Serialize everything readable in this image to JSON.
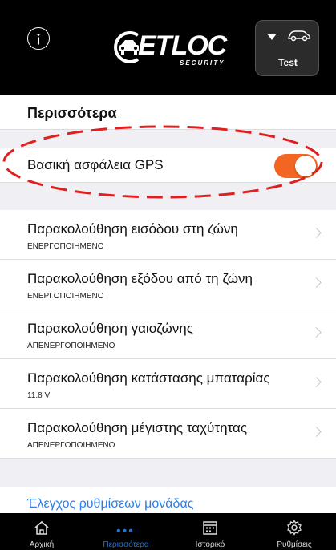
{
  "header": {
    "logo_text": "ETLOC",
    "logo_subtext": "SECURITY",
    "vehicle_name": "Test",
    "icons": {
      "info": "info-icon",
      "car": "car-icon",
      "caret": "caret-down-icon"
    }
  },
  "section": {
    "title": "Περισσότερα"
  },
  "gps": {
    "label": "Βασική ασφάλεια GPS",
    "enabled": true,
    "toggle_color": "#f26522"
  },
  "rows": [
    {
      "title": "Παρακολούθηση εισόδου στη ζώνη",
      "status": "ΕΝΕΡΓΟΠΟΙΗΜΕΝΟ"
    },
    {
      "title": "Παρακολούθηση εξόδου από τη ζώνη",
      "status": "ΕΝΕΡΓΟΠΟΙΗΜΕΝΟ"
    },
    {
      "title": "Παρακολούθηση γαιοζώνης",
      "status": "ΑΠΕΝΕΡΓΟΠΟΙΗΜΕΝΟ"
    },
    {
      "title": "Παρακολούθηση κατάστασης μπαταρίας",
      "status": "11.8 V"
    },
    {
      "title": "Παρακολούθηση μέγιστης ταχύτητας",
      "status": "ΑΠΕΝΕΡΓΟΠΟΙΗΜΕΝΟ"
    }
  ],
  "config_link": "Έλεγχος ρυθμίσεων μονάδας",
  "tabs": [
    {
      "label": "Αρχική",
      "icon": "home-icon",
      "active": false
    },
    {
      "label": "Περισσότερα",
      "icon": "more-dots-icon",
      "active": true
    },
    {
      "label": "Ιστορικό",
      "icon": "calendar-icon",
      "active": false
    },
    {
      "label": "Ρυθμίσεις",
      "icon": "gear-icon",
      "active": false
    }
  ],
  "colors": {
    "accent": "#f26522",
    "link": "#2b7de9",
    "active_tab": "#2f6fcf",
    "annotation": "#e02020"
  }
}
